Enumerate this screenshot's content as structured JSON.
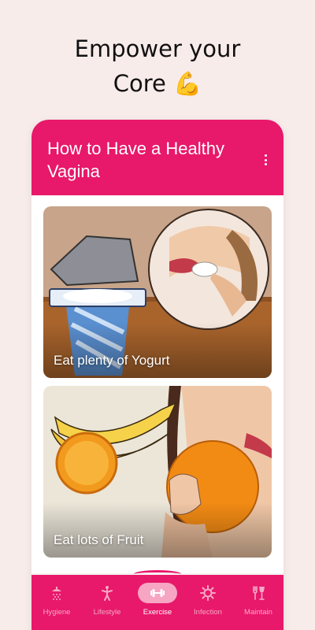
{
  "promo": {
    "line1": "Empower your",
    "line2": "Core 💪"
  },
  "app": {
    "title": "How to Have a Healthy Vagina",
    "cards": [
      {
        "label": "Eat plenty of Yogurt"
      },
      {
        "label": "Eat lots of Fruit"
      }
    ],
    "nav": [
      {
        "label": "Hygiene",
        "icon": "shower-icon",
        "active": false
      },
      {
        "label": "Lifestyle",
        "icon": "stretching-person-icon",
        "active": false
      },
      {
        "label": "Exercise",
        "icon": "dumbbell-icon",
        "active": true
      },
      {
        "label": "Infection",
        "icon": "virus-icon",
        "active": false
      },
      {
        "label": "Maintain",
        "icon": "fork-glass-icon",
        "active": false
      }
    ]
  },
  "colors": {
    "primary": "#e8186a",
    "background": "#f8ecea",
    "nav_active_pill": "#f6a5c2"
  }
}
